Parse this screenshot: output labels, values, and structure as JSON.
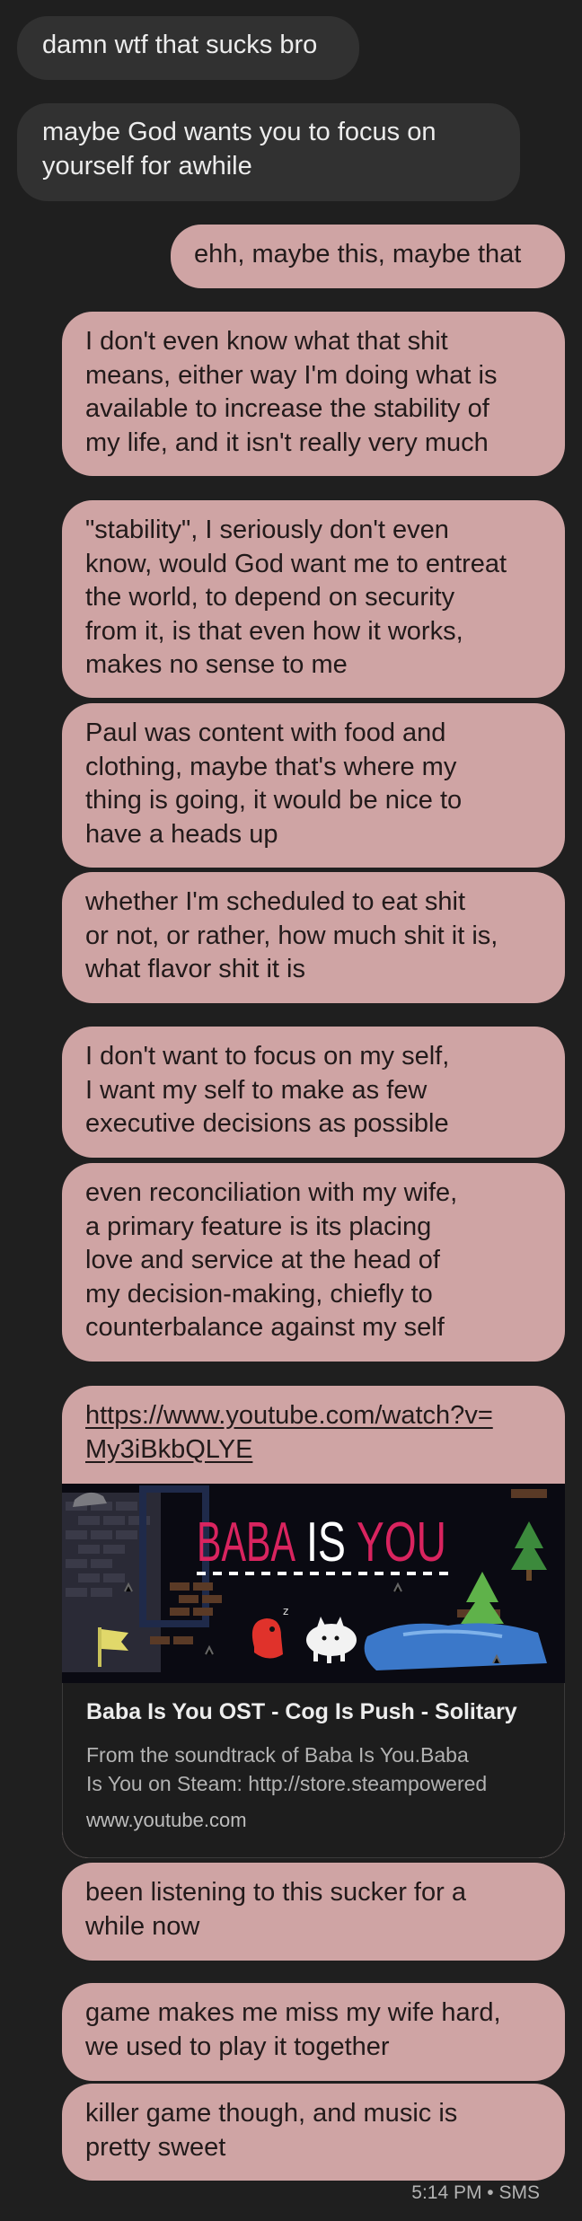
{
  "messages": [
    {
      "dir": "in",
      "text": "damn wtf that sucks bro"
    },
    {
      "dir": "in",
      "text": "maybe God wants you to focus on\nyourself for awhile"
    },
    {
      "dir": "out",
      "text": "ehh, maybe this, maybe that"
    },
    {
      "dir": "out",
      "text": "I don't even know what that shit\nmeans, either way I'm doing what is\navailable to increase the stability of\nmy life, and it isn't really very much"
    },
    {
      "dir": "out",
      "text": "\"stability\", I seriously don't even\nknow, would God want me to entreat\nthe world, to depend on security\nfrom it, is that even how it works,\nmakes no sense to me"
    },
    {
      "dir": "out",
      "text": "Paul was content with food and\nclothing, maybe that's where my\nthing is going, it would be nice to\nhave a heads up"
    },
    {
      "dir": "out",
      "text": "whether I'm scheduled to eat shit\nor not, or rather, how much shit it is,\nwhat flavor shit it is"
    },
    {
      "dir": "out",
      "text": "I don't want to focus on my self,\nI want my self to make as few\nexecutive decisions as possible"
    },
    {
      "dir": "out",
      "text": "even reconciliation with my wife,\na primary feature is its placing\nlove and service at the head of\nmy decision-making, chiefly to\ncounterbalance against my self"
    },
    {
      "dir": "out",
      "text": "been listening to this sucker for a\nwhile now"
    },
    {
      "dir": "out",
      "text": "game makes me miss my wife hard,\nwe used to play it together"
    },
    {
      "dir": "out",
      "text": "killer game though, and music is\npretty sweet"
    }
  ],
  "link_card": {
    "url": "https://www.youtube.com/watch?v=\nMy3iBkbQLYE",
    "thumbnail_title_left": "BABA",
    "thumbnail_title_mid": "IS",
    "thumbnail_title_right": "YOU",
    "title": "Baba Is You OST - Cog Is Push - Solitary",
    "description": "From the soundtrack of Baba Is You.Baba\nIs You on Steam: http://store.steampowered",
    "domain": "www.youtube.com"
  },
  "status": "5:14 PM • SMS",
  "colors": {
    "background": "#1f1f1f",
    "incoming_bubble": "#313131",
    "outgoing_bubble": "#cfa4a4",
    "preview_panel": "#1d1d1d",
    "baba_pink": "#d9245f"
  }
}
